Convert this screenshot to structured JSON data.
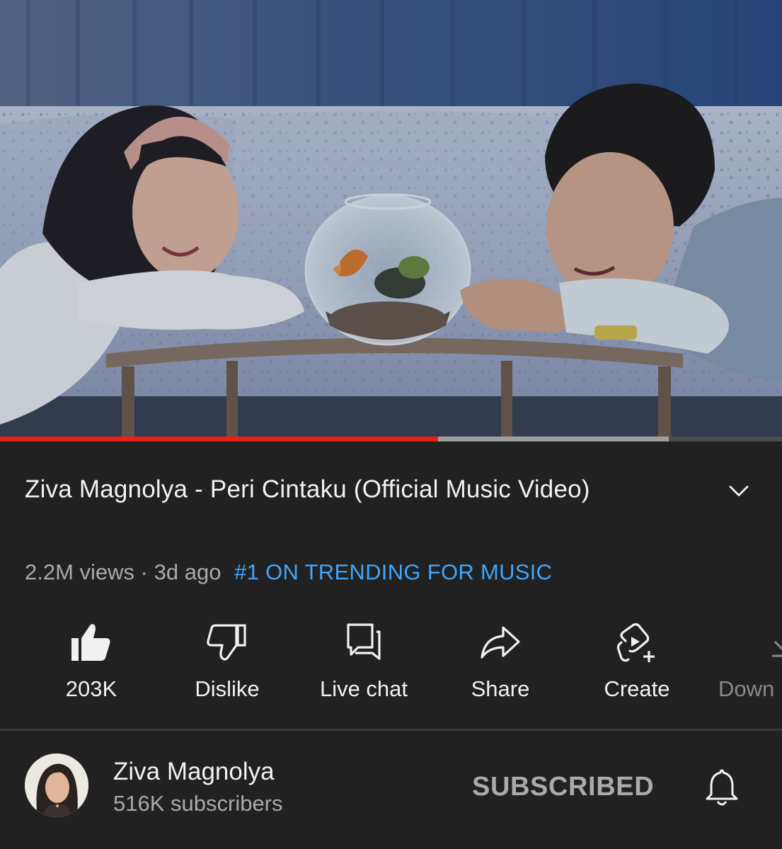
{
  "video": {
    "progress_played_fraction": 0.56,
    "progress_buffered_fraction": 0.855,
    "colors": {
      "played": "#e62117",
      "buffered": "#9e9e9e",
      "track": "#4d4d4d"
    }
  },
  "info": {
    "title": "Ziva Magnolya - Peri Cintaku (Official Music Video)",
    "views": "2.2M views",
    "separator": "·",
    "age": "3d ago",
    "trending": "#1 ON TRENDING FOR MUSIC",
    "expand_icon": "chevron-down-icon",
    "trending_color": "#3ea6ff"
  },
  "actions": [
    {
      "id": "like",
      "label": "203K",
      "icon": "thumbs-up-filled-icon"
    },
    {
      "id": "dislike",
      "label": "Dislike",
      "icon": "thumbs-down-icon"
    },
    {
      "id": "live-chat",
      "label": "Live chat",
      "icon": "chat-icon"
    },
    {
      "id": "share",
      "label": "Share",
      "icon": "share-arrow-icon"
    },
    {
      "id": "create",
      "label": "Create",
      "icon": "create-plus-icon"
    },
    {
      "id": "download",
      "label": "Down",
      "icon": "download-icon"
    }
  ],
  "channel": {
    "name": "Ziva Magnolya",
    "subscribers": "516K subscribers",
    "subscribe_label": "SUBSCRIBED",
    "bell_icon": "bell-icon"
  }
}
